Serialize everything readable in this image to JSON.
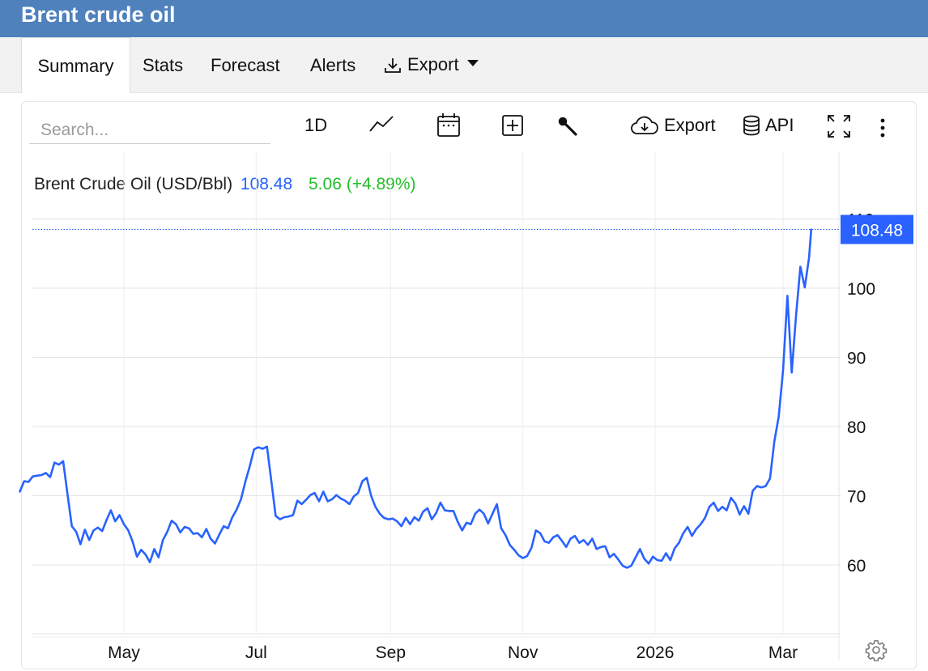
{
  "app": {
    "title": "Brent crude oil"
  },
  "tabs": [
    {
      "label": "Summary",
      "active": true
    },
    {
      "label": "Stats"
    },
    {
      "label": "Forecast"
    },
    {
      "label": "Alerts"
    },
    {
      "label": "Export",
      "icon": "download-icon",
      "dropdown": true
    }
  ],
  "toolbar": {
    "search_placeholder": "Search...",
    "interval_label": "1D",
    "chart_type_icon": "line-chart-icon",
    "date_range_icon": "calendar-icon",
    "compare_icon": "plus-square-icon",
    "indicators_icon": "wrench-icon",
    "export_label": "Export",
    "export_icon": "cloud-download-icon",
    "api_label": "API",
    "api_icon": "database-icon",
    "fullscreen_icon": "fullscreen-icon",
    "more_icon": "more-vertical-icon",
    "settings_icon": "gear-icon"
  },
  "legend": {
    "name": "Brent Crude Oil (USD/Bbl)",
    "price": "108.48",
    "change": "5.06 (+4.89%)"
  },
  "colors": {
    "header": "#4f81bd",
    "line": "#2962ff",
    "positive": "#22c02a",
    "price_label_bg": "#2962ff"
  },
  "chart_data": {
    "type": "line",
    "series": [
      {
        "name": "Brent Crude Oil (USD/Bbl)",
        "points": [
          [
            "2025-03-14",
            70.6
          ],
          [
            "2025-03-16",
            72.1
          ],
          [
            "2025-03-18",
            72.0
          ],
          [
            "2025-03-20",
            72.8
          ],
          [
            "2025-03-22",
            72.9
          ],
          [
            "2025-03-24",
            73.0
          ],
          [
            "2025-03-26",
            73.3
          ],
          [
            "2025-03-28",
            72.7
          ],
          [
            "2025-03-30",
            74.8
          ],
          [
            "2025-04-01",
            74.5
          ],
          [
            "2025-04-03",
            75.0
          ],
          [
            "2025-04-05",
            70.2
          ],
          [
            "2025-04-07",
            65.6
          ],
          [
            "2025-04-09",
            64.8
          ],
          [
            "2025-04-11",
            63.0
          ],
          [
            "2025-04-13",
            65.1
          ],
          [
            "2025-04-15",
            63.6
          ],
          [
            "2025-04-17",
            65.0
          ],
          [
            "2025-04-19",
            65.4
          ],
          [
            "2025-04-21",
            64.9
          ],
          [
            "2025-04-23",
            66.5
          ],
          [
            "2025-04-25",
            67.9
          ],
          [
            "2025-04-27",
            66.3
          ],
          [
            "2025-04-29",
            67.2
          ],
          [
            "2025-05-01",
            65.9
          ],
          [
            "2025-05-03",
            65.0
          ],
          [
            "2025-05-05",
            63.4
          ],
          [
            "2025-05-07",
            61.2
          ],
          [
            "2025-05-09",
            62.2
          ],
          [
            "2025-05-11",
            61.5
          ],
          [
            "2025-05-13",
            60.4
          ],
          [
            "2025-05-15",
            62.3
          ],
          [
            "2025-05-17",
            61.1
          ],
          [
            "2025-05-19",
            63.6
          ],
          [
            "2025-05-21",
            64.8
          ],
          [
            "2025-05-23",
            66.4
          ],
          [
            "2025-05-25",
            65.9
          ],
          [
            "2025-05-27",
            64.7
          ],
          [
            "2025-05-29",
            65.5
          ],
          [
            "2025-05-31",
            65.3
          ],
          [
            "2025-06-02",
            64.5
          ],
          [
            "2025-06-04",
            64.6
          ],
          [
            "2025-06-06",
            64.0
          ],
          [
            "2025-06-08",
            65.2
          ],
          [
            "2025-06-10",
            63.8
          ],
          [
            "2025-06-12",
            63.1
          ],
          [
            "2025-06-14",
            64.4
          ],
          [
            "2025-06-16",
            65.6
          ],
          [
            "2025-06-18",
            65.3
          ],
          [
            "2025-06-20",
            66.9
          ],
          [
            "2025-06-22",
            68.0
          ],
          [
            "2025-06-24",
            69.5
          ],
          [
            "2025-06-26",
            72.0
          ],
          [
            "2025-06-28",
            74.2
          ],
          [
            "2025-06-30",
            76.7
          ],
          [
            "2025-07-02",
            77.0
          ],
          [
            "2025-07-04",
            76.8
          ],
          [
            "2025-07-06",
            77.1
          ],
          [
            "2025-07-08",
            72.1
          ],
          [
            "2025-07-10",
            67.1
          ],
          [
            "2025-07-12",
            66.6
          ],
          [
            "2025-07-14",
            66.9
          ],
          [
            "2025-07-16",
            67.0
          ],
          [
            "2025-07-18",
            67.2
          ],
          [
            "2025-07-20",
            69.3
          ],
          [
            "2025-07-22",
            68.8
          ],
          [
            "2025-07-24",
            69.4
          ],
          [
            "2025-07-26",
            70.1
          ],
          [
            "2025-07-28",
            70.4
          ],
          [
            "2025-07-30",
            69.2
          ],
          [
            "2025-08-01",
            70.6
          ],
          [
            "2025-08-03",
            69.2
          ],
          [
            "2025-08-05",
            69.5
          ],
          [
            "2025-08-07",
            70.1
          ],
          [
            "2025-08-09",
            69.6
          ],
          [
            "2025-08-11",
            69.3
          ],
          [
            "2025-08-13",
            68.8
          ],
          [
            "2025-08-15",
            69.9
          ],
          [
            "2025-08-17",
            70.4
          ],
          [
            "2025-08-19",
            72.1
          ],
          [
            "2025-08-21",
            72.6
          ],
          [
            "2025-08-23",
            70.0
          ],
          [
            "2025-08-25",
            68.4
          ],
          [
            "2025-08-27",
            67.4
          ],
          [
            "2025-08-29",
            66.8
          ],
          [
            "2025-08-31",
            66.6
          ],
          [
            "2025-09-02",
            66.7
          ],
          [
            "2025-09-04",
            66.3
          ],
          [
            "2025-09-06",
            65.6
          ],
          [
            "2025-09-08",
            66.8
          ],
          [
            "2025-09-10",
            65.9
          ],
          [
            "2025-09-12",
            66.9
          ],
          [
            "2025-09-14",
            66.4
          ],
          [
            "2025-09-16",
            67.7
          ],
          [
            "2025-09-18",
            68.2
          ],
          [
            "2025-09-20",
            66.6
          ],
          [
            "2025-09-22",
            67.5
          ],
          [
            "2025-09-24",
            69.0
          ],
          [
            "2025-09-26",
            67.9
          ],
          [
            "2025-09-28",
            67.8
          ],
          [
            "2025-09-30",
            67.8
          ],
          [
            "2025-10-02",
            66.2
          ],
          [
            "2025-10-04",
            65.0
          ],
          [
            "2025-10-06",
            66.1
          ],
          [
            "2025-10-08",
            65.9
          ],
          [
            "2025-10-10",
            67.4
          ],
          [
            "2025-10-12",
            68.0
          ],
          [
            "2025-10-14",
            67.4
          ],
          [
            "2025-10-16",
            66.0
          ],
          [
            "2025-10-18",
            67.4
          ],
          [
            "2025-10-20",
            68.8
          ],
          [
            "2025-10-22",
            65.3
          ],
          [
            "2025-10-24",
            64.3
          ],
          [
            "2025-10-26",
            62.9
          ],
          [
            "2025-10-28",
            62.2
          ],
          [
            "2025-10-30",
            61.4
          ],
          [
            "2025-11-01",
            61.0
          ],
          [
            "2025-11-03",
            61.3
          ],
          [
            "2025-11-05",
            62.5
          ],
          [
            "2025-11-07",
            65.0
          ],
          [
            "2025-11-09",
            64.6
          ],
          [
            "2025-11-11",
            63.4
          ],
          [
            "2025-11-13",
            63.2
          ],
          [
            "2025-11-15",
            64.0
          ],
          [
            "2025-11-17",
            64.3
          ],
          [
            "2025-11-19",
            63.5
          ],
          [
            "2025-11-21",
            62.6
          ],
          [
            "2025-11-23",
            63.8
          ],
          [
            "2025-11-25",
            64.2
          ],
          [
            "2025-11-27",
            63.2
          ],
          [
            "2025-11-29",
            63.6
          ],
          [
            "2025-12-01",
            62.9
          ],
          [
            "2025-12-03",
            63.8
          ],
          [
            "2025-12-05",
            62.3
          ],
          [
            "2025-12-07",
            62.6
          ],
          [
            "2025-12-09",
            62.7
          ],
          [
            "2025-12-11",
            61.1
          ],
          [
            "2025-12-13",
            61.6
          ],
          [
            "2025-12-15",
            60.8
          ],
          [
            "2025-12-17",
            59.9
          ],
          [
            "2025-12-19",
            59.6
          ],
          [
            "2025-12-21",
            59.9
          ],
          [
            "2025-12-23",
            61.1
          ],
          [
            "2025-12-25",
            62.3
          ],
          [
            "2025-12-27",
            60.9
          ],
          [
            "2025-12-29",
            60.2
          ],
          [
            "2025-12-31",
            61.2
          ],
          [
            "2026-01-02",
            60.7
          ],
          [
            "2026-01-04",
            60.6
          ],
          [
            "2026-01-06",
            61.7
          ],
          [
            "2026-01-08",
            60.7
          ],
          [
            "2026-01-10",
            62.4
          ],
          [
            "2026-01-12",
            63.2
          ],
          [
            "2026-01-14",
            64.6
          ],
          [
            "2026-01-16",
            65.5
          ],
          [
            "2026-01-18",
            64.2
          ],
          [
            "2026-01-20",
            65.2
          ],
          [
            "2026-01-22",
            65.9
          ],
          [
            "2026-01-24",
            66.8
          ],
          [
            "2026-01-26",
            68.4
          ],
          [
            "2026-01-28",
            69.0
          ],
          [
            "2026-01-30",
            67.8
          ],
          [
            "2026-02-01",
            68.4
          ],
          [
            "2026-02-03",
            67.9
          ],
          [
            "2026-02-05",
            69.7
          ],
          [
            "2026-02-07",
            68.9
          ],
          [
            "2026-02-09",
            67.3
          ],
          [
            "2026-02-11",
            68.5
          ],
          [
            "2026-02-13",
            67.4
          ],
          [
            "2026-02-15",
            70.7
          ],
          [
            "2026-02-17",
            71.4
          ],
          [
            "2026-02-19",
            71.2
          ],
          [
            "2026-02-21",
            71.4
          ],
          [
            "2026-02-23",
            72.5
          ],
          [
            "2026-02-25",
            77.9
          ],
          [
            "2026-02-27",
            81.4
          ],
          [
            "2026-03-01",
            88.1
          ],
          [
            "2026-03-03",
            98.9
          ],
          [
            "2026-03-05",
            87.8
          ],
          [
            "2026-03-07",
            96.1
          ],
          [
            "2026-03-09",
            103.1
          ],
          [
            "2026-03-11",
            100.1
          ],
          [
            "2026-03-13",
            104.4
          ],
          [
            "2026-03-14",
            108.48
          ]
        ]
      }
    ],
    "x_ticks": [
      "May",
      "Jul",
      "Sep",
      "Nov",
      "2026",
      "Mar"
    ],
    "y_ticks": [
      60,
      70,
      80,
      90,
      100,
      110
    ],
    "ylim": [
      50,
      110
    ],
    "last_value": 108.48,
    "grid": true,
    "y_axis_side": "right"
  }
}
